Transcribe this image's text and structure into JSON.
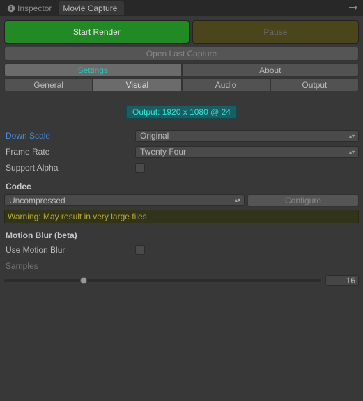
{
  "window_tabs": {
    "inspector": "Inspector",
    "active": "Movie Capture"
  },
  "buttons": {
    "start_render": "Start Render",
    "pause": "Pause",
    "open_last": "Open Last Capture",
    "configure": "Configure"
  },
  "main_tabs": {
    "settings": "Settings",
    "about": "About"
  },
  "sub_tabs": {
    "general": "General",
    "visual": "Visual",
    "audio": "Audio",
    "output": "Output"
  },
  "output_banner": "Output: 1920 x 1080 @ 24",
  "fields": {
    "down_scale": {
      "label": "Down Scale",
      "value": "Original"
    },
    "frame_rate": {
      "label": "Frame Rate",
      "value": "Twenty Four"
    },
    "support_alpha": {
      "label": "Support Alpha"
    },
    "codec": {
      "heading": "Codec",
      "value": "Uncompressed"
    },
    "warning": "Warning: May result in very large files",
    "motion_blur": {
      "heading": "Motion Blur (beta)",
      "use_label": "Use Motion Blur",
      "samples_label": "Samples",
      "samples_value": "16"
    }
  },
  "slider": {
    "percent": 24
  }
}
